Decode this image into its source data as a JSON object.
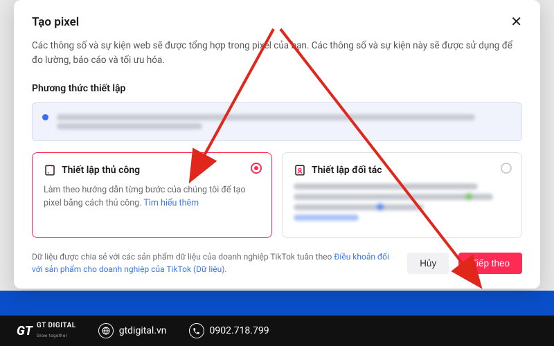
{
  "modal": {
    "title": "Tạo pixel",
    "description": "Các thông số và sự kiện web sẽ được tổng hợp trong pixel của bạn. Các thông số và sự kiện này sẽ được sử dụng để đo lường, báo cáo và tối ưu hóa.",
    "section_title": "Phương thức thiết lập"
  },
  "cards": {
    "manual": {
      "title": "Thiết lập thủ công",
      "description": "Làm theo hướng dẫn từng bước của chúng tôi để tạo pixel bằng cách thủ công. ",
      "learn_more": "Tìm hiểu thêm"
    },
    "partner": {
      "title": "Thiết lập đối tác"
    }
  },
  "footer": {
    "text_prefix": "Dữ liệu được chia sẻ với các sản phẩm dữ liệu của doanh nghiệp TikTok tuân theo ",
    "link": "Điều khoản đối với sản phẩm cho doanh nghiệp của TikTok (Dữ liệu)",
    "text_suffix": ".",
    "cancel": "Hủy",
    "next": "Tiếp theo"
  },
  "contact": {
    "brand_main": "GT DIGITAL",
    "brand_sub": "Grow together",
    "website": "gtdigital.vn",
    "phone": "0902.718.799"
  }
}
